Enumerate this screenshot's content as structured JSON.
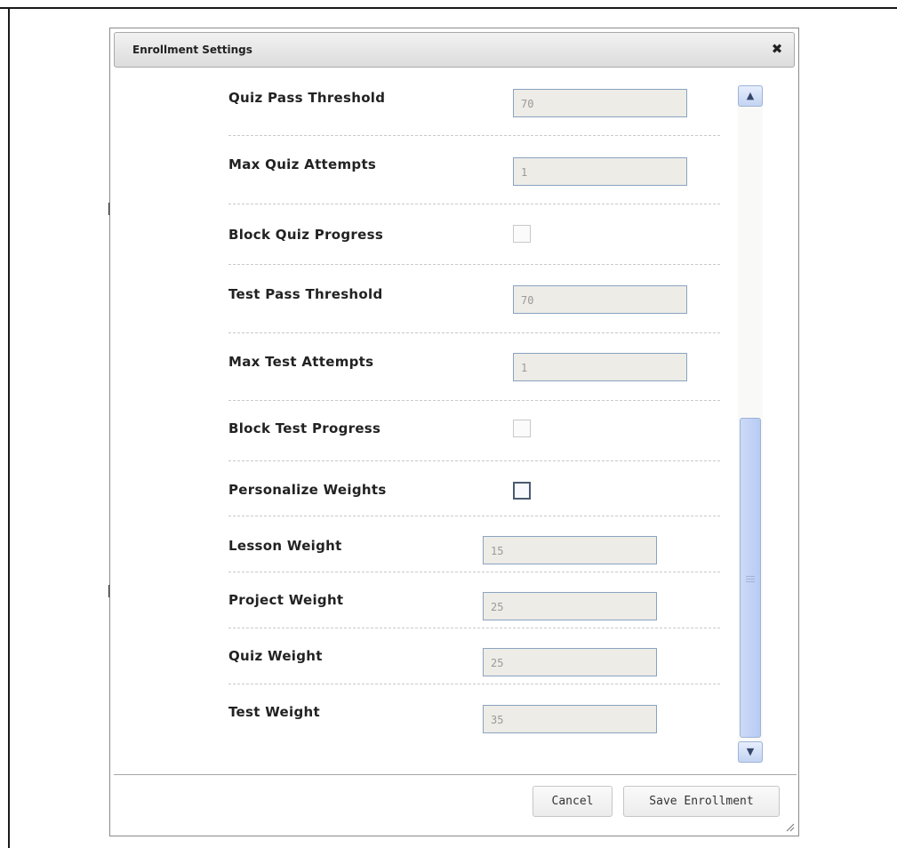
{
  "dialog": {
    "title": "Enrollment Settings",
    "close_icon": "close-icon"
  },
  "fields": [
    {
      "label": "Quiz Pass Threshold",
      "value": "70"
    },
    {
      "label": "Max Quiz Attempts",
      "value": "1"
    },
    {
      "label": "Block Quiz Progress",
      "checked": false
    },
    {
      "label": "Test Pass Threshold",
      "value": "70"
    },
    {
      "label": "Max Test Attempts",
      "value": "1"
    },
    {
      "label": "Block Test Progress",
      "checked": false
    },
    {
      "label": "Personalize Weights",
      "checked": false
    },
    {
      "label": "Lesson Weight",
      "value": "15"
    },
    {
      "label": "Project Weight",
      "value": "25"
    },
    {
      "label": "Quiz Weight",
      "value": "25"
    },
    {
      "label": "Test Weight",
      "value": "35"
    }
  ],
  "footer": {
    "cancel_label": "Cancel",
    "save_label": "Save Enrollment"
  }
}
